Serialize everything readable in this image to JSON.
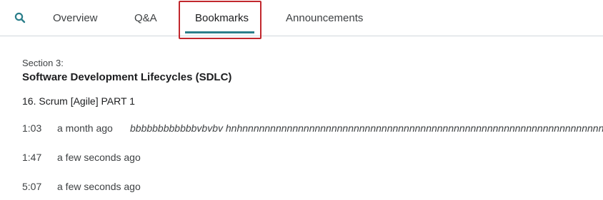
{
  "tabs": {
    "overview": "Overview",
    "qa": "Q&A",
    "bookmarks": "Bookmarks",
    "announcements": "Announcements"
  },
  "section": {
    "label": "Section 3:",
    "title": "Software Development Lifecycles (SDLC)"
  },
  "lecture": {
    "title": "16. Scrum [Agile] PART 1"
  },
  "bookmarks": [
    {
      "time": "1:03",
      "ago": "a month ago",
      "note": "bbbbbbbbbbbbvbvbv hnhnnnnnnnnnnnnnnnnnnnnnnnnnnnnnnnnnnnnnnnnnnnnnnnnnnnnnnnnnnnnnnnnnn"
    },
    {
      "time": "1:47",
      "ago": "a few seconds ago",
      "note": ""
    },
    {
      "time": "5:07",
      "ago": "a few seconds ago",
      "note": ""
    }
  ],
  "colors": {
    "accent": "#2b7e8a",
    "highlight_border": "#c1272d"
  },
  "icons": {
    "search": "search-icon"
  }
}
